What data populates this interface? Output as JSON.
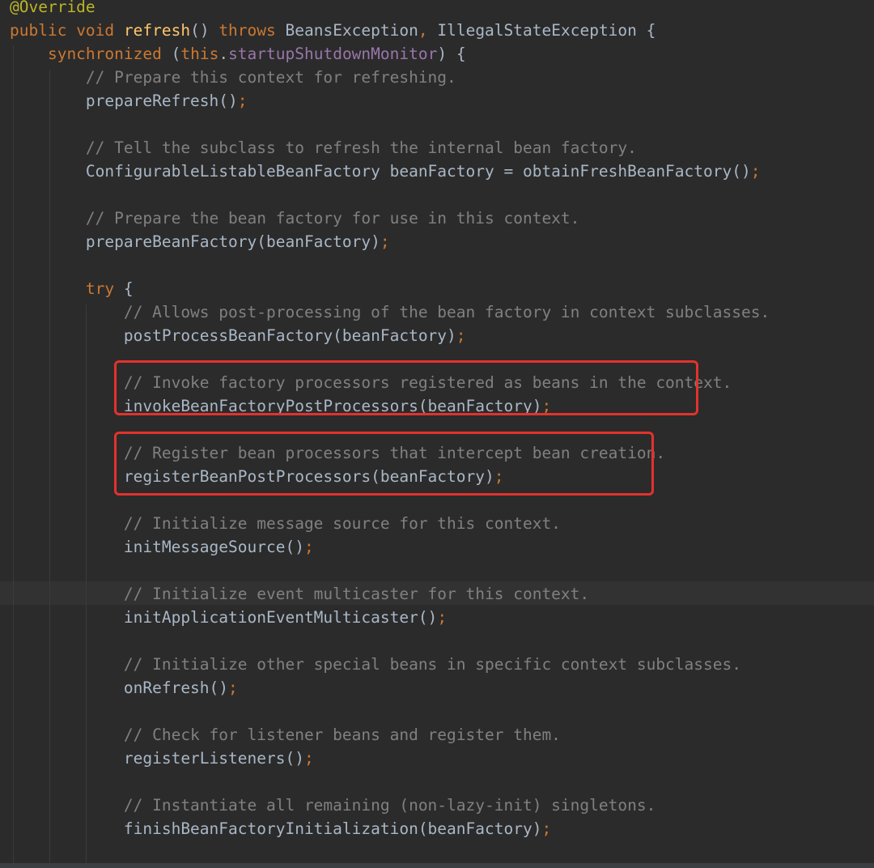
{
  "editor": {
    "lines": [
      [
        {
          "t": "@Override",
          "c": "ann"
        }
      ],
      [
        {
          "t": "public ",
          "c": "kw"
        },
        {
          "t": "void ",
          "c": "kw"
        },
        {
          "t": "refresh",
          "c": "fn"
        },
        {
          "t": "() ",
          "c": "pl"
        },
        {
          "t": "throws ",
          "c": "kw"
        },
        {
          "t": "BeansException",
          "c": "pl"
        },
        {
          "t": ", ",
          "c": "punc"
        },
        {
          "t": "IllegalStateException {",
          "c": "pl"
        }
      ],
      [
        {
          "t": "    synchronized ",
          "c": "kw"
        },
        {
          "t": "(",
          "c": "pl"
        },
        {
          "t": "this",
          "c": "kw"
        },
        {
          "t": ".",
          "c": "pl"
        },
        {
          "t": "startupShutdownMonitor",
          "c": "fld"
        },
        {
          "t": ") {",
          "c": "pl"
        }
      ],
      [
        {
          "t": "        // Prepare this context for refreshing.",
          "c": "cm"
        }
      ],
      [
        {
          "t": "        prepareRefresh()",
          "c": "pl"
        },
        {
          "t": ";",
          "c": "punc"
        }
      ],
      [],
      [
        {
          "t": "        // Tell the subclass to refresh the internal bean factory.",
          "c": "cm"
        }
      ],
      [
        {
          "t": "        ConfigurableListableBeanFactory beanFactory = obtainFreshBeanFactory()",
          "c": "pl"
        },
        {
          "t": ";",
          "c": "punc"
        }
      ],
      [],
      [
        {
          "t": "        // Prepare the bean factory for use in this context.",
          "c": "cm"
        }
      ],
      [
        {
          "t": "        prepareBeanFactory(beanFactory)",
          "c": "pl"
        },
        {
          "t": ";",
          "c": "punc"
        }
      ],
      [],
      [
        {
          "t": "        try ",
          "c": "kw"
        },
        {
          "t": "{",
          "c": "pl"
        }
      ],
      [
        {
          "t": "            // Allows post-processing of the bean factory in context subclasses.",
          "c": "cm"
        }
      ],
      [
        {
          "t": "            postProcessBeanFactory(beanFactory)",
          "c": "pl"
        },
        {
          "t": ";",
          "c": "punc"
        }
      ],
      [],
      [
        {
          "t": "            // Invoke factory processors registered as beans in the context.",
          "c": "cm"
        }
      ],
      [
        {
          "t": "            invokeBeanFactoryPostProcessors(beanFactory)",
          "c": "pl"
        },
        {
          "t": ";",
          "c": "punc"
        }
      ],
      [],
      [
        {
          "t": "            // Register bean processors that intercept bean creation.",
          "c": "cm"
        }
      ],
      [
        {
          "t": "            registerBeanPostProcessors(beanFactory)",
          "c": "pl"
        },
        {
          "t": ";",
          "c": "punc"
        }
      ],
      [],
      [
        {
          "t": "            // Initialize message source for this context.",
          "c": "cm"
        }
      ],
      [
        {
          "t": "            initMessageSource()",
          "c": "pl"
        },
        {
          "t": ";",
          "c": "punc"
        }
      ],
      [],
      [
        {
          "t": "            // Initialize event multicaster for this context.",
          "c": "cm"
        }
      ],
      [
        {
          "t": "            initApplicationEventMulticaster()",
          "c": "pl"
        },
        {
          "t": ";",
          "c": "punc"
        }
      ],
      [],
      [
        {
          "t": "            // Initialize other special beans in specific context subclasses.",
          "c": "cm"
        }
      ],
      [
        {
          "t": "            onRefresh()",
          "c": "pl"
        },
        {
          "t": ";",
          "c": "punc"
        }
      ],
      [],
      [
        {
          "t": "            // Check for listener beans and register them.",
          "c": "cm"
        }
      ],
      [
        {
          "t": "            registerListeners()",
          "c": "pl"
        },
        {
          "t": ";",
          "c": "punc"
        }
      ],
      [],
      [
        {
          "t": "            // Instantiate all remaining (non-lazy-init) singletons.",
          "c": "cm"
        }
      ],
      [
        {
          "t": "            finishBeanFactoryInitialization(beanFactory)",
          "c": "pl"
        },
        {
          "t": ";",
          "c": "punc"
        }
      ]
    ]
  },
  "colors": {
    "background": "#2b2b2b",
    "keyword": "#cc7832",
    "annotation": "#bbb529",
    "method_declaration": "#ffc66d",
    "field": "#9876aa",
    "comment": "#808080",
    "plain": "#a9b7c6",
    "highlight_box": "#e3322e"
  }
}
